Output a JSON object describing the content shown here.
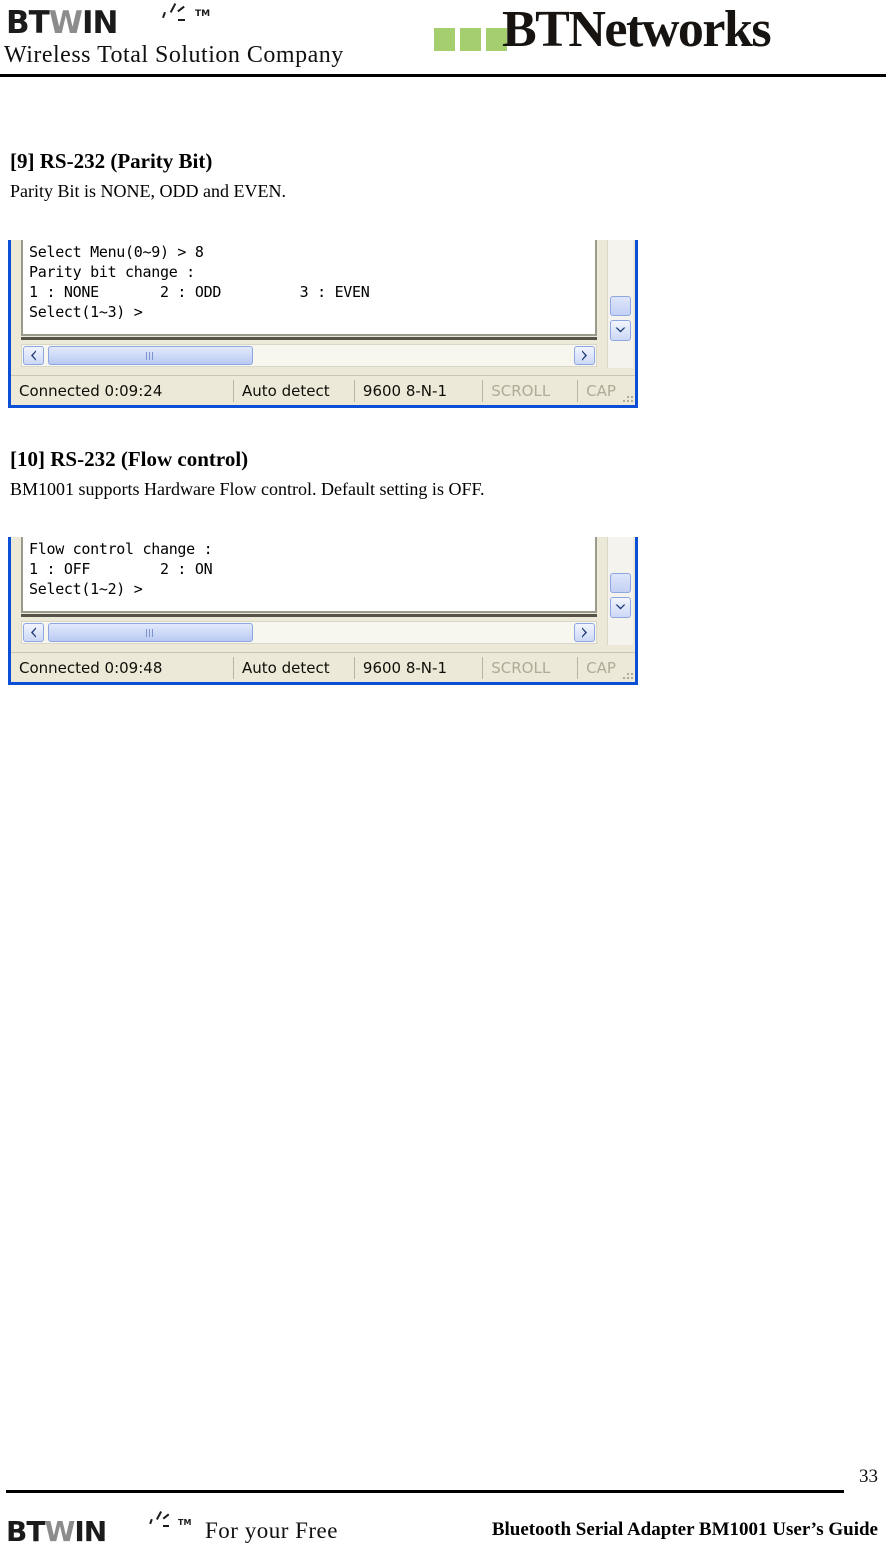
{
  "header": {
    "brand_primary": {
      "bt": "BT",
      "w": "W",
      "in": "IN",
      "trademark": "TM"
    },
    "tagline": "Wireless Total Solution Company",
    "brand_secondary": {
      "word": "BTNetworks",
      "square_color": "#A5CE6E",
      "squares": 3
    }
  },
  "sections": [
    {
      "title": "[9] RS-232 (Parity Bit)",
      "body": "Parity Bit is NONE, ODD and EVEN.",
      "terminal": {
        "lines": [
          "Select Menu(0~9) > 8",
          "Parity bit change :",
          "1 : NONE       2 : ODD         3 : EVEN",
          "Select(1~3) >"
        ],
        "status": {
          "connected": "Connected 0:09:24",
          "detect": "Auto detect",
          "serial": "9600 8-N-1",
          "scroll": "SCROLL",
          "caps": "CAP"
        },
        "border_color": "#0B4FD6"
      }
    },
    {
      "title": "[10] RS-232 (Flow control)",
      "body": "BM1001 supports Hardware Flow control. Default setting is OFF.",
      "terminal": {
        "lines": [
          "Flow control change :",
          "1 : OFF        2 : ON",
          "Select(1~2) >"
        ],
        "status": {
          "connected": "Connected 0:09:48",
          "detect": "Auto detect",
          "serial": "9600 8-N-1",
          "scroll": "SCROLL",
          "caps": "CAP"
        },
        "border_color": "#0B4FD6"
      }
    }
  ],
  "footer": {
    "page_number": "33",
    "brand": {
      "bt": "BT",
      "w": "W",
      "in": "IN",
      "trademark": "TM"
    },
    "slogan": "For your Free",
    "document_title": "Bluetooth Serial Adapter BM1001 User’s Guide"
  }
}
